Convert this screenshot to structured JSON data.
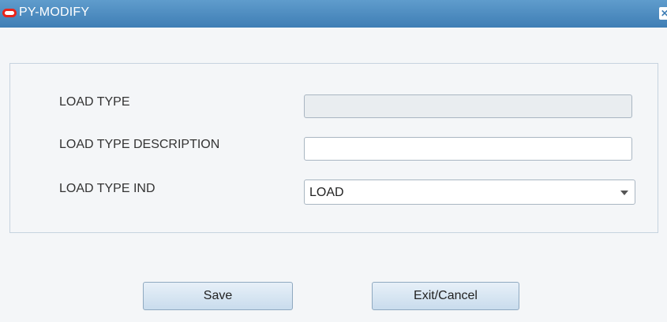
{
  "window": {
    "title": "PY-MODIFY",
    "close_glyph": "✕"
  },
  "form": {
    "load_type": {
      "label": "LOAD TYPE",
      "value": ""
    },
    "load_type_description": {
      "label": "LOAD TYPE DESCRIPTION",
      "value": ""
    },
    "load_type_ind": {
      "label": "LOAD TYPE IND",
      "selected": "LOAD"
    }
  },
  "buttons": {
    "save_label": "Save",
    "exit_label": "Exit/Cancel"
  },
  "colors": {
    "titlebar": "#3f7eb5",
    "logo": "#e8231a",
    "button_fill": "#c9dced"
  },
  "icons": [
    "oracle-logo-icon",
    "close-icon",
    "dropdown-arrow-icon"
  ]
}
